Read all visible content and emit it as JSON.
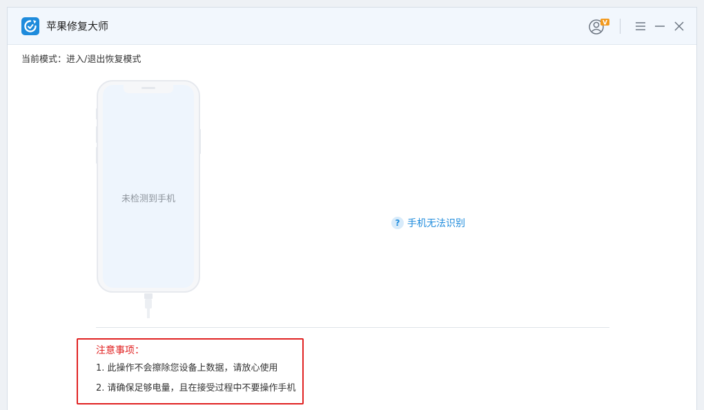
{
  "app": {
    "title": "苹果修复大师",
    "accent_color": "#1e8bdc",
    "logo_icon": "refresh-arrow-icon"
  },
  "titlebar": {
    "avatar_badge": "V",
    "controls": [
      "menu-icon",
      "minimize-icon",
      "close-icon"
    ]
  },
  "main": {
    "mode_label": "当前模式：进入/退出恢复模式",
    "device_status": "未检测到手机",
    "help_link": "手机无法识别",
    "help_icon": "?"
  },
  "notice": {
    "title": "注意事项：",
    "items": [
      "1. 此操作不会擦除您设备上数据，请放心使用",
      "2. 请确保足够电量，且在接受过程中不要操作手机"
    ],
    "border_color": "#e02020"
  }
}
